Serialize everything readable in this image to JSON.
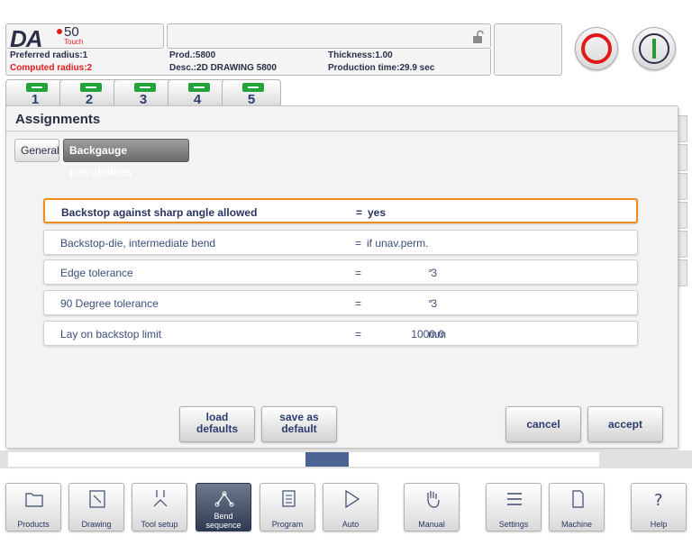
{
  "header": {
    "brand": {
      "logo": "DA",
      "model": "50",
      "sub": "Touch"
    },
    "info": {
      "preferred_radius": "Preferred radius:1",
      "computed_radius": "Computed radius:2",
      "prod": "Prod.:5800",
      "desc": "Desc.:2D DRAWING 5800",
      "thickness": "Thickness:1.00",
      "production_time": "Production time:29.9 sec"
    },
    "icons": {
      "lock": "lock-open-icon",
      "stop": "stop-icon",
      "start": "start-icon"
    },
    "colors": {
      "stop": "#e01a1a",
      "start": "#2a9a3a",
      "computed_radius": "#e01c1c"
    }
  },
  "bend_tabs": [
    {
      "label": "1"
    },
    {
      "label": "2"
    },
    {
      "label": "3"
    },
    {
      "label": "4"
    },
    {
      "label": "5"
    }
  ],
  "dialog": {
    "title": "Assignments",
    "tabs": {
      "general": "General",
      "backgauge": "Backgauge possibilities"
    },
    "rows": [
      {
        "label": "Backstop against sharp angle allowed",
        "eq": "=",
        "value": "yes",
        "unit": ""
      },
      {
        "label": "Backstop-die, intermediate bend",
        "eq": "=",
        "value": "if unav.perm.",
        "unit": ""
      },
      {
        "label": "Edge tolerance",
        "eq": "=",
        "value": "3",
        "unit": "°"
      },
      {
        "label": "90 Degree tolerance",
        "eq": "=",
        "value": "3",
        "unit": "°"
      },
      {
        "label": "Lay on backstop limit",
        "eq": "=",
        "value": "1000.0",
        "unit": "mm"
      }
    ],
    "buttons": {
      "load_line1": "load",
      "load_line2": "defaults",
      "save_line1": "save as",
      "save_line2": "default",
      "cancel": "cancel",
      "accept": "accept"
    },
    "colors": {
      "selected_border": "#f08c1a"
    }
  },
  "nav": [
    {
      "label": "Products",
      "icon": "folder-icon"
    },
    {
      "label": "Drawing",
      "icon": "drawing-icon"
    },
    {
      "label": "Tool setup",
      "icon": "tool-setup-icon"
    },
    {
      "label": "Bend sequence",
      "icon": "bend-sequence-icon"
    },
    {
      "label": "Program",
      "icon": "program-icon"
    },
    {
      "label": "Auto",
      "icon": "play-icon"
    },
    {
      "label": "Manual",
      "icon": "hand-icon"
    },
    {
      "label": "Settings",
      "icon": "settings-icon"
    },
    {
      "label": "Machine",
      "icon": "machine-icon"
    },
    {
      "label": "Help",
      "icon": "help-icon"
    }
  ]
}
